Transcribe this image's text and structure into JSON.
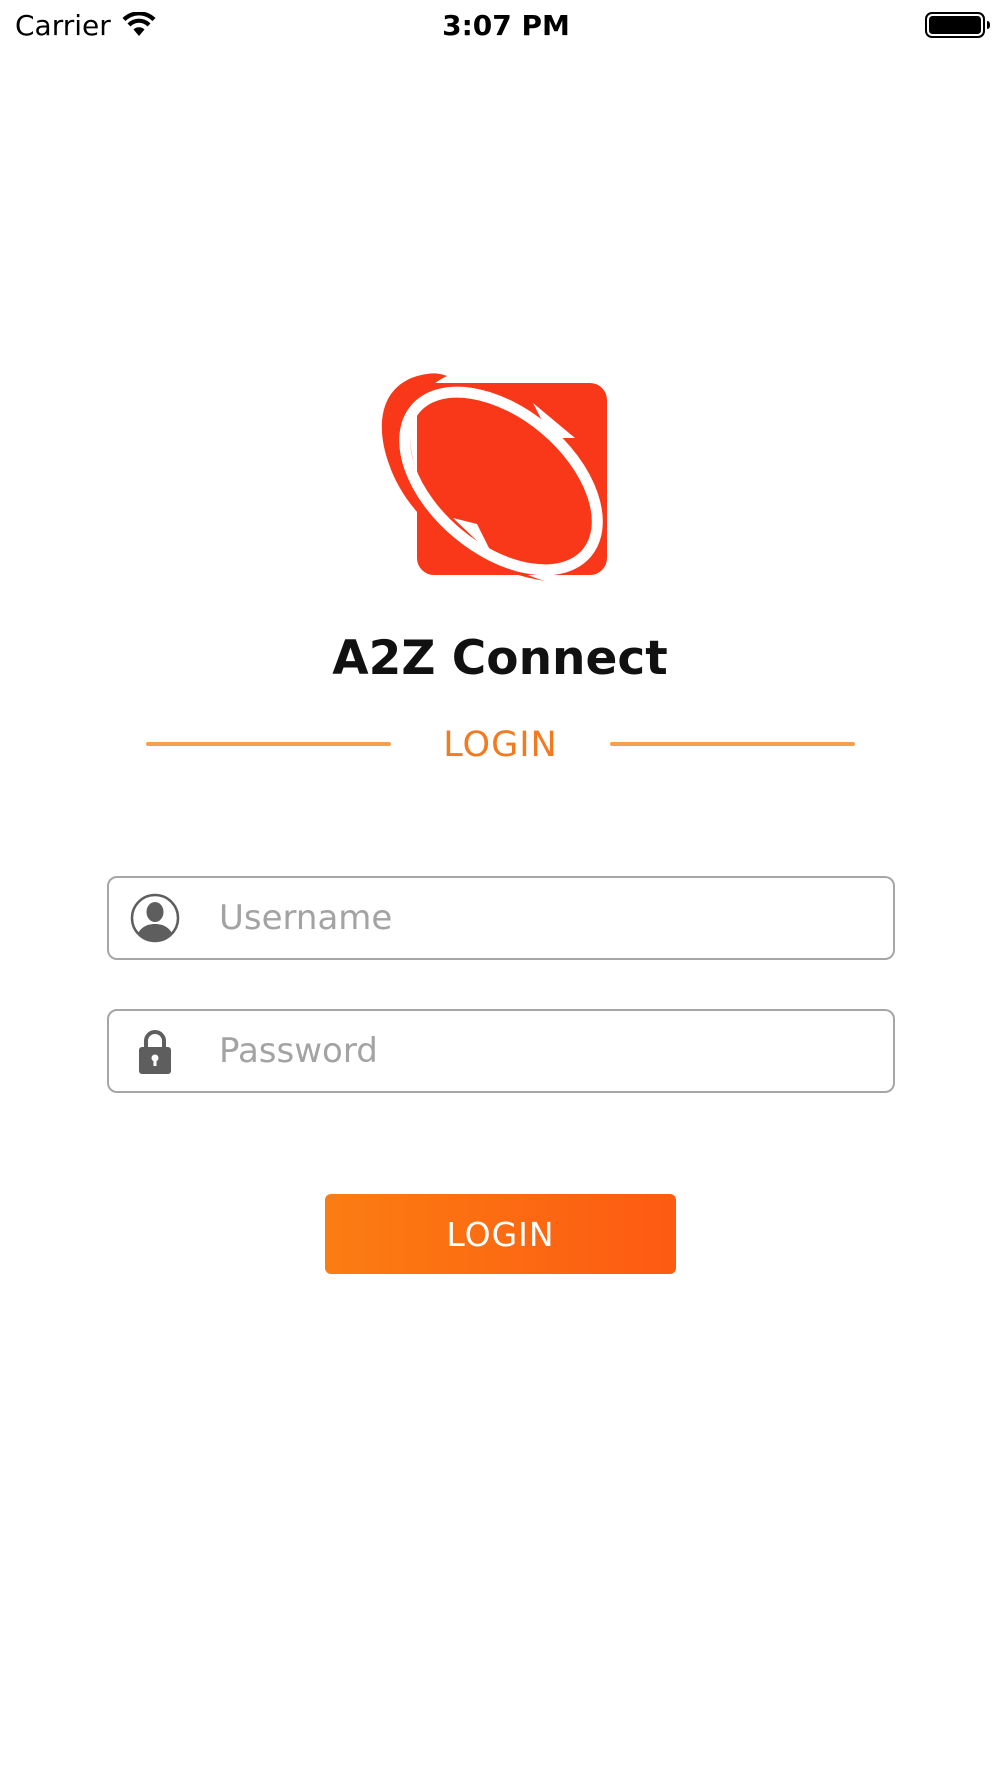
{
  "status_bar": {
    "carrier": "Carrier",
    "time": "3:07 PM",
    "icons": [
      "wifi-icon",
      "battery-icon"
    ]
  },
  "app": {
    "title": "A2Z Connect",
    "logo": "a2z-connect-logo",
    "section_label": "LOGIN"
  },
  "form": {
    "username": {
      "placeholder": "Username",
      "value": "",
      "icon": "user-icon"
    },
    "password": {
      "placeholder": "Password",
      "value": "",
      "icon": "lock-icon"
    },
    "login_button": "LOGIN"
  },
  "colors": {
    "brand_red": "#f83818",
    "accent_orange": "#f47a20",
    "divider": "#f5a050",
    "button_gradient_start": "#fb7d12",
    "button_gradient_end": "#fd5a12",
    "field_border": "#a6a6a6",
    "placeholder": "#a3a3a3",
    "icon_gray": "#5e5e5e"
  }
}
